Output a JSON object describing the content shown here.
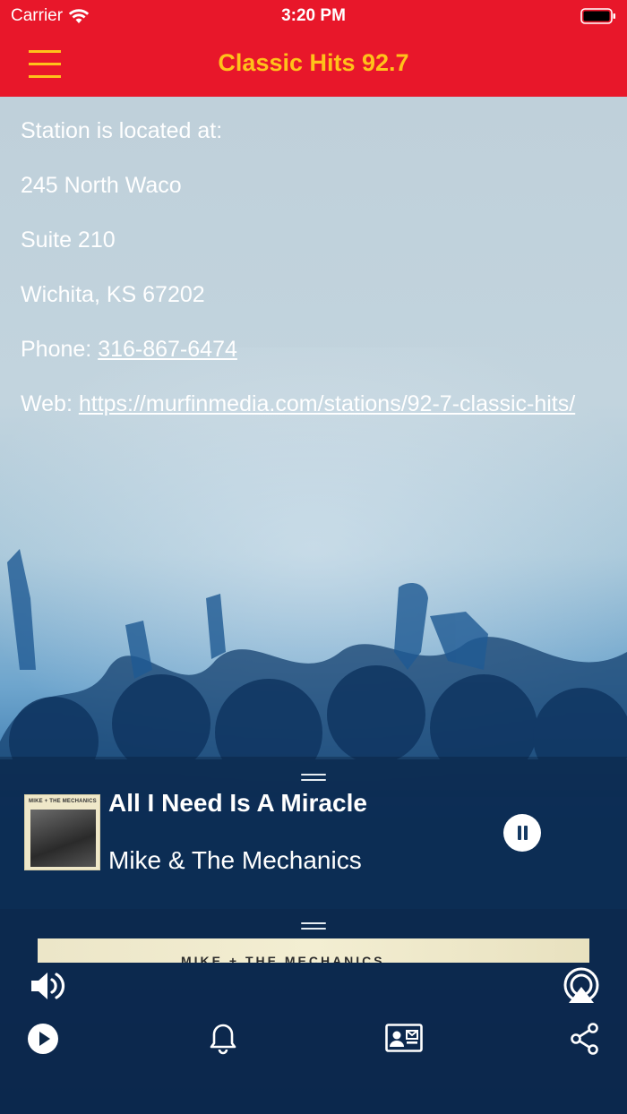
{
  "status_bar": {
    "carrier": "Carrier",
    "time": "3:20 PM"
  },
  "nav": {
    "title": "Classic Hits 92.7",
    "title_color": "#ffc21a",
    "bar_color": "#e8172a",
    "menu_icon": "hamburger-menu-icon"
  },
  "content": {
    "intro": "Station is located at:",
    "address_line1": "245 North Waco",
    "address_line2": "Suite 210",
    "city_line": "Wichita, KS 67202",
    "phone_label": "Phone: ",
    "phone": "316-867-6474",
    "web_label": "Web: ",
    "web_url": "https://murfinmedia.com/stations/92-7-classic-hits/"
  },
  "now_playing": {
    "title": "All I Need Is A Miracle",
    "artist": "Mike & The Mechanics",
    "cover_text": "MIKE + THE MECHANICS",
    "art_peek_text": "MIKE + THE MECHANICS"
  },
  "controls": {
    "volume_icon": "volume-icon",
    "airplay_icon": "airplay-icon",
    "play_icon": "play-icon",
    "alarm_icon": "bell-icon",
    "contact_icon": "contact-card-icon",
    "share_icon": "share-icon"
  }
}
